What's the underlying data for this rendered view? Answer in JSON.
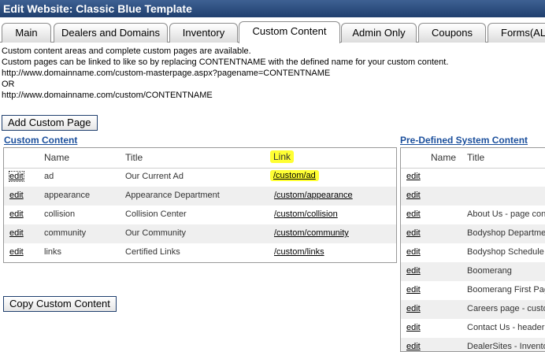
{
  "window": {
    "title": "Edit Website: Classic Blue Template"
  },
  "tabs": [
    {
      "label": "Main"
    },
    {
      "label": "Dealers and Domains"
    },
    {
      "label": "Inventory"
    },
    {
      "label": "Custom Content",
      "active": true
    },
    {
      "label": "Admin Only"
    },
    {
      "label": "Coupons"
    },
    {
      "label": "Forms(ALPHA)"
    }
  ],
  "description": {
    "line1": "Custom content areas and complete custom pages are available.",
    "line2": "Custom pages can be linked to like so by replacing CONTENTNAME with the defined name for your custom content.",
    "line3": "http://www.domainname.com/custom-masterpage.aspx?pagename=CONTENTNAME",
    "line4": "OR",
    "line5": "http://www.domainname.com/custom/CONTENTNAME"
  },
  "buttons": {
    "add_custom_page": "Add Custom Page",
    "copy_custom_content": "Copy Custom Content"
  },
  "custom_content": {
    "heading": "Custom Content",
    "columns": {
      "name": "Name",
      "title": "Title",
      "link": "Link"
    },
    "rows": [
      {
        "action": "edit",
        "name": "ad",
        "title": "Our Current Ad",
        "link": "/custom/ad"
      },
      {
        "action": "edit",
        "name": "appearance",
        "title": "Appearance Department",
        "link": "/custom/appearance"
      },
      {
        "action": "edit",
        "name": "collision",
        "title": "Collision Center",
        "link": "/custom/collision"
      },
      {
        "action": "edit",
        "name": "community",
        "title": "Our Community",
        "link": "/custom/community"
      },
      {
        "action": "edit",
        "name": "links",
        "title": "Certified Links",
        "link": "/custom/links"
      }
    ]
  },
  "predefined": {
    "heading": "Pre-Defined System Content",
    "columns": {
      "name": "Name",
      "title": "Title"
    },
    "rows": [
      {
        "action": "edit",
        "title": ""
      },
      {
        "action": "edit",
        "title": ""
      },
      {
        "action": "edit",
        "title": "About Us - page content"
      },
      {
        "action": "edit",
        "title": "Bodyshop Department"
      },
      {
        "action": "edit",
        "title": "Bodyshop Schedule"
      },
      {
        "action": "edit",
        "title": "Boomerang"
      },
      {
        "action": "edit",
        "title": "Boomerang First Page"
      },
      {
        "action": "edit",
        "title": "Careers page - custom"
      },
      {
        "action": "edit",
        "title": "Contact Us - header"
      },
      {
        "action": "edit",
        "title": "DealerSites - Inventory"
      }
    ]
  },
  "colors": {
    "titlebar": "#2b4d7e",
    "link_blue": "#1b4f9c",
    "highlight": "#ffff33"
  }
}
